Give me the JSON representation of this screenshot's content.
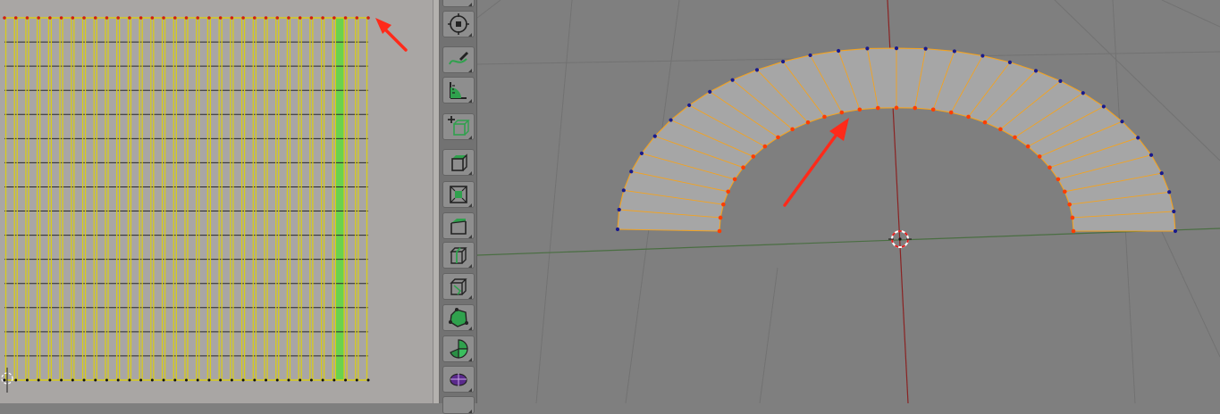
{
  "uv_editor": {
    "background": "#a9a6a4",
    "grid_color": "#2a2a2a",
    "edge_color": "#d8cc1a",
    "selected_face_color": "#6ad24e",
    "strip_count": 32,
    "selected_strip_index": 29,
    "row_count": 15
  },
  "viewport": {
    "background": "#7f7f7f",
    "face_fill": "#a6a6a6",
    "edge_color": "#f3a321",
    "selected_vertex_color": "#ff3d00",
    "unselected_vertex_color": "#1a1a8c",
    "x_axis_color": "#4a6e42",
    "y_axis_color": "#8a2323",
    "segment_count": 30
  },
  "annotations": {
    "arrow_color": "#ff2a1a"
  },
  "toolbar": {
    "tools": [
      {
        "icon": "origin-transform-icon"
      },
      {
        "icon": "draw-curve-icon"
      },
      {
        "icon": "measure-angle-icon"
      },
      {
        "icon": "add-cube-icon"
      },
      {
        "icon": "extrude-region-icon"
      },
      {
        "icon": "inset-faces-icon"
      },
      {
        "icon": "bevel-icon"
      },
      {
        "icon": "loop-cut-icon"
      },
      {
        "icon": "knife-icon"
      },
      {
        "icon": "poly-build-icon"
      },
      {
        "icon": "spin-icon"
      },
      {
        "icon": "smooth-icon"
      }
    ]
  }
}
